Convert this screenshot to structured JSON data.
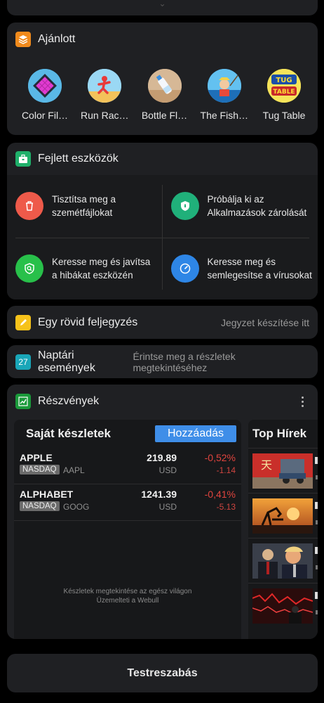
{
  "recommended": {
    "title": "Ajánlott",
    "apps": [
      {
        "label": "Color Fil…",
        "icon": "color-fill-game-icon"
      },
      {
        "label": "Run Rac…",
        "icon": "run-race-game-icon"
      },
      {
        "label": "Bottle Fl…",
        "icon": "bottle-flip-game-icon"
      },
      {
        "label": "The Fish…",
        "icon": "fishing-game-icon"
      },
      {
        "label": "Tug Table",
        "icon": "tug-table-game-icon"
      }
    ]
  },
  "tools": {
    "title": "Fejlett eszközök",
    "items": [
      {
        "label": "Tisztítsa meg a szemétfájlokat",
        "icon": "trash-icon",
        "color": "#ee5a4a"
      },
      {
        "label": "Próbálja ki az Alkalmazások zárolását",
        "icon": "shield-lock-icon",
        "color": "#20b07a"
      },
      {
        "label": "Keresse meg és javítsa a hibákat eszközén",
        "icon": "shield-search-icon",
        "color": "#28c04a"
      },
      {
        "label": "Keresse meg és semlegesítse a vírusokat",
        "icon": "speed-gauge-icon",
        "color": "#2e86e6"
      }
    ]
  },
  "note": {
    "title": "Egy rövid feljegyzés",
    "action": "Jegyzet készítése itt"
  },
  "calendar": {
    "title": "Naptári események",
    "day": "27",
    "action": "Érintse meg a részletek megtekintéséhez"
  },
  "stocks": {
    "title": "Részvények",
    "holdings_title": "Saját készletek",
    "add_label": "Hozzáadás",
    "rows": [
      {
        "name": "APPLE",
        "exchange": "NASDAQ",
        "ticker": "AAPL",
        "price": "219.89",
        "currency": "USD",
        "pct": "-0,52%",
        "change": "-1.14"
      },
      {
        "name": "ALPHABET",
        "exchange": "NASDAQ",
        "ticker": "GOOG",
        "price": "1241.39",
        "currency": "USD",
        "pct": "-0,41%",
        "change": "-5.13"
      }
    ],
    "footer_line1": "Készletek megtekintése az egész világon",
    "footer_line2": "Üzemelteti a Webull",
    "news_title": "Top Hírek"
  },
  "customize_label": "Testreszabás",
  "colors": {
    "card_bg": "#1f2023",
    "accent_blue": "#3f8ee8",
    "negative_red": "#e0443e"
  }
}
